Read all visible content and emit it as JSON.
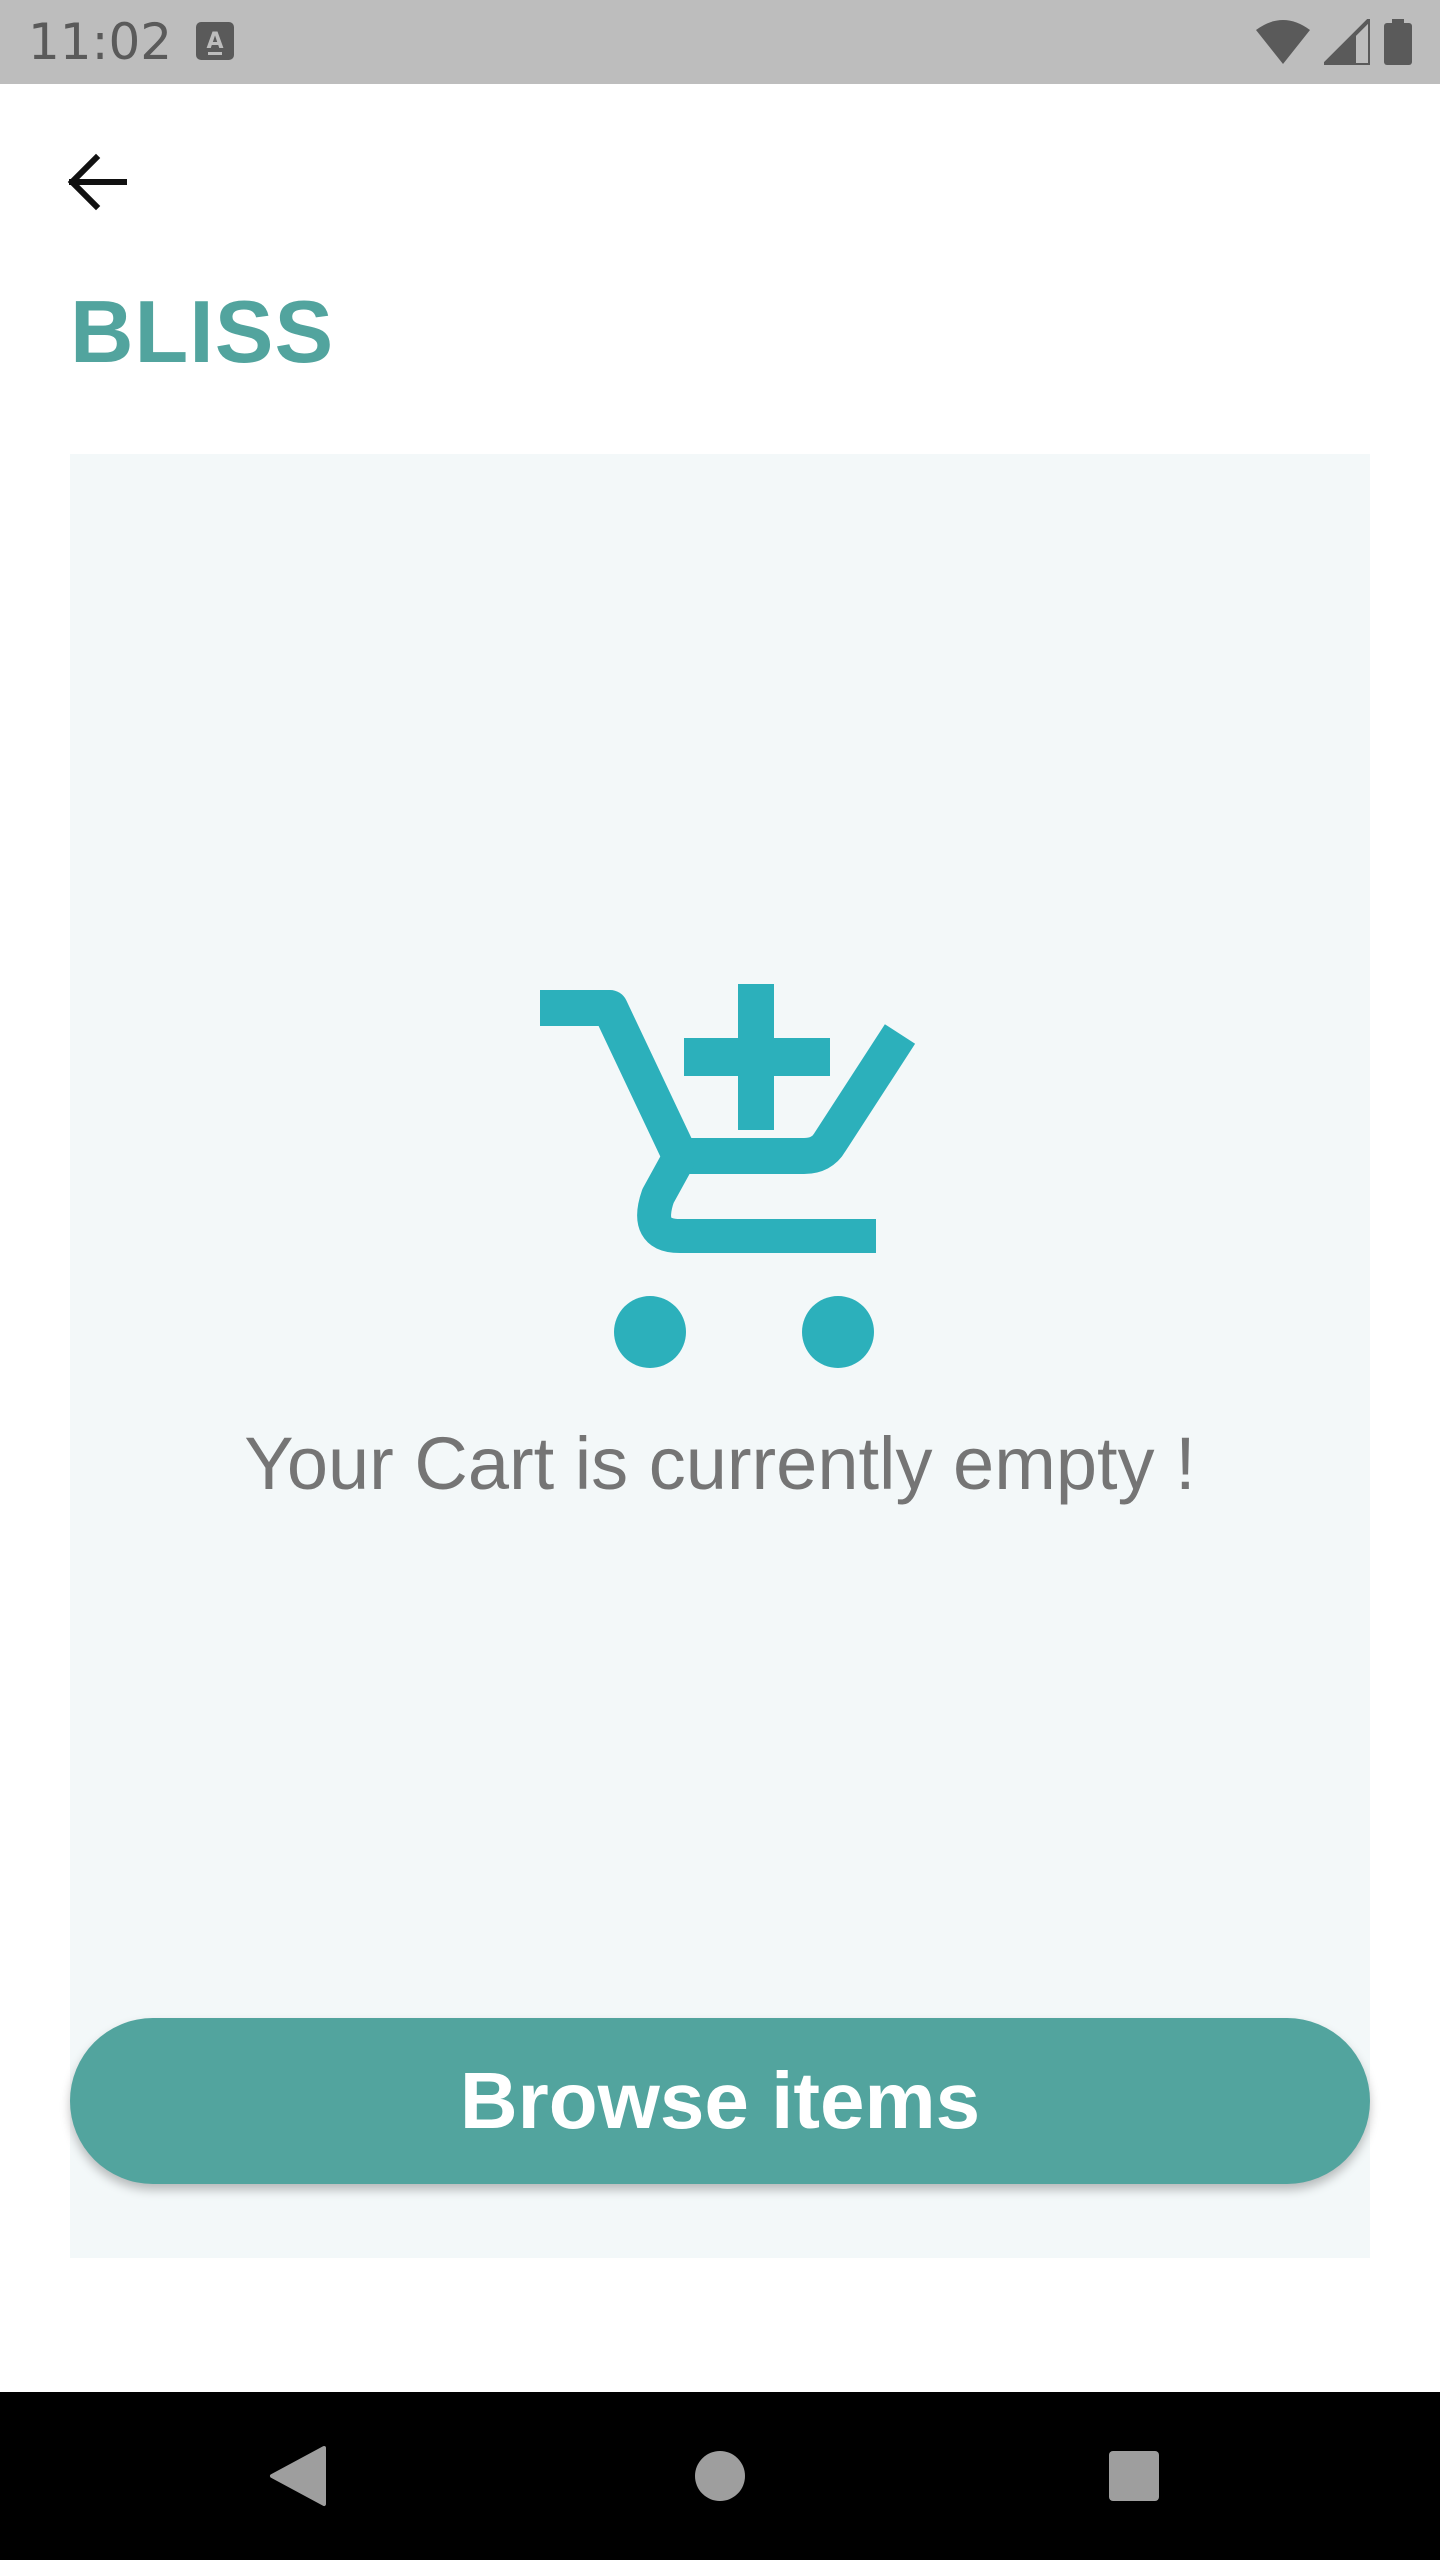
{
  "status_bar": {
    "time": "11:02",
    "icons": [
      "keyboard-a-icon",
      "wifi-icon",
      "cell-signal-icon",
      "battery-icon"
    ],
    "background": "#bdbdbd"
  },
  "header": {
    "back_icon": "arrow-back-icon",
    "brand": "BLISS",
    "brand_color": "#52a49e"
  },
  "cart": {
    "icon": "cart-add-icon",
    "icon_color": "#2cb0bb",
    "empty_message": "Your Cart is currently empty !",
    "button_label": "Browse items",
    "button_color": "#52a49e",
    "panel_color": "#f3f8f9"
  },
  "nav_bar": {
    "icons": [
      "nav-back-icon",
      "nav-home-icon",
      "nav-recents-icon"
    ]
  }
}
